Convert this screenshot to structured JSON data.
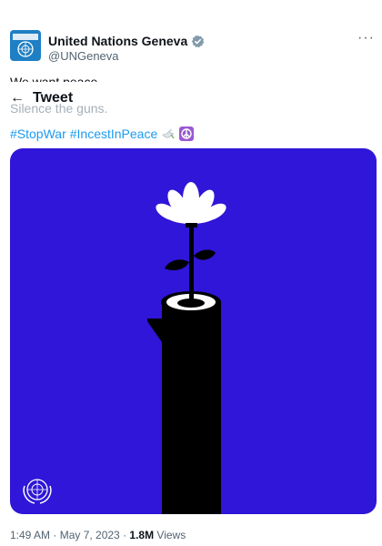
{
  "tweet": {
    "display_name": "United Nations Geneva",
    "handle": "@UNGeneva",
    "text_line1": "We want peace.",
    "text_line2": "Silence the guns.",
    "hashtags": [
      "#StopWar",
      "#IncestInPeace"
    ],
    "timestamp": "1:49 AM · May 7, 2023 · ",
    "views_count": "1.8M",
    "views_label": " Views"
  },
  "header": {
    "title": "Tweet",
    "back_icon": "arrow-left-icon"
  },
  "icons": {
    "verified": "verified-badge-icon",
    "more": "more-icon"
  },
  "colors": {
    "link": "#1d9bf0",
    "media_background": "#2f16d8",
    "avatar": "#1f7fc4"
  }
}
